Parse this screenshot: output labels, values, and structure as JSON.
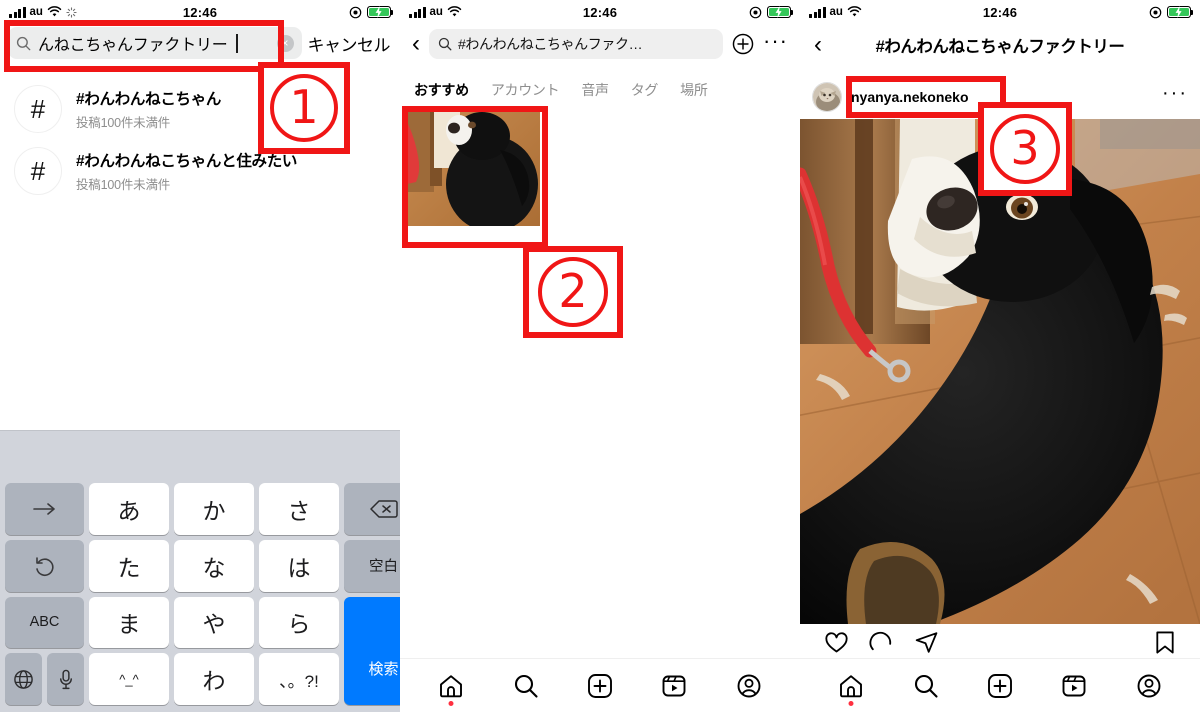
{
  "meta": {
    "accent_red": "#f01616",
    "ig_blue": "#007aff",
    "gray_text": "#8e8e8e"
  },
  "status_bar": {
    "carrier": "au",
    "time": "12:46"
  },
  "left_panel": {
    "search": {
      "value": "んねこちゃんファクトリー",
      "clear_label": "×",
      "cancel_label": "キャンセル"
    },
    "results": [
      {
        "hash": "#",
        "title": "#わんわんねこちゃん",
        "subtitle": "投稿100件未満件"
      },
      {
        "hash": "#",
        "title": "#わんわんねこちゃんと住みたい",
        "subtitle": "投稿100件未満件"
      }
    ],
    "keyboard": {
      "rows": [
        [
          "→",
          "あ",
          "か",
          "さ",
          "⌫"
        ],
        [
          "↺",
          "た",
          "な",
          "は",
          "空白"
        ],
        [
          "ABC",
          "ま",
          "や",
          "ら",
          "検索"
        ],
        [
          "🌐|🎤",
          "^_^",
          "わ",
          "、。?!",
          ""
        ]
      ],
      "keys": {
        "arrow_right": "→",
        "a": "あ",
        "ka": "か",
        "sa": "さ",
        "backspace": "⌫",
        "undo": "↺",
        "ta": "た",
        "na": "な",
        "ha": "は",
        "space": "空白",
        "abc": "ABC",
        "ma": "ま",
        "ya": "や",
        "ra": "ら",
        "search": "検索",
        "globe": "🌐",
        "mic": "🎤",
        "emoji": "^_^",
        "wa": "わ",
        "punct": "、。?!"
      }
    }
  },
  "mid_panel": {
    "search_value": "#わんわんねこちゃんファク…",
    "back_label": "‹",
    "more_label": "···",
    "tabs": [
      {
        "label": "おすすめ",
        "active": true
      },
      {
        "label": "アカウント",
        "active": false
      },
      {
        "label": "音声",
        "active": false
      },
      {
        "label": "タグ",
        "active": false
      },
      {
        "label": "場所",
        "active": false
      }
    ],
    "nav": [
      "home-icon",
      "search-icon",
      "add-icon",
      "reels-icon",
      "profile-icon"
    ]
  },
  "right_panel": {
    "title": "#わんわんねこちゃんファクトリー",
    "back_label": "‹",
    "username": "nyanya.nekoneko",
    "post_more_label": "···",
    "actions": [
      "like-icon",
      "comment-icon",
      "share-icon",
      "bookmark-icon"
    ],
    "nav": [
      "home-icon",
      "search-icon",
      "add-icon",
      "reels-icon",
      "profile-icon"
    ]
  },
  "annotations": [
    {
      "id": "1",
      "label": "①"
    },
    {
      "id": "2",
      "label": "②"
    },
    {
      "id": "3",
      "label": "③"
    }
  ]
}
